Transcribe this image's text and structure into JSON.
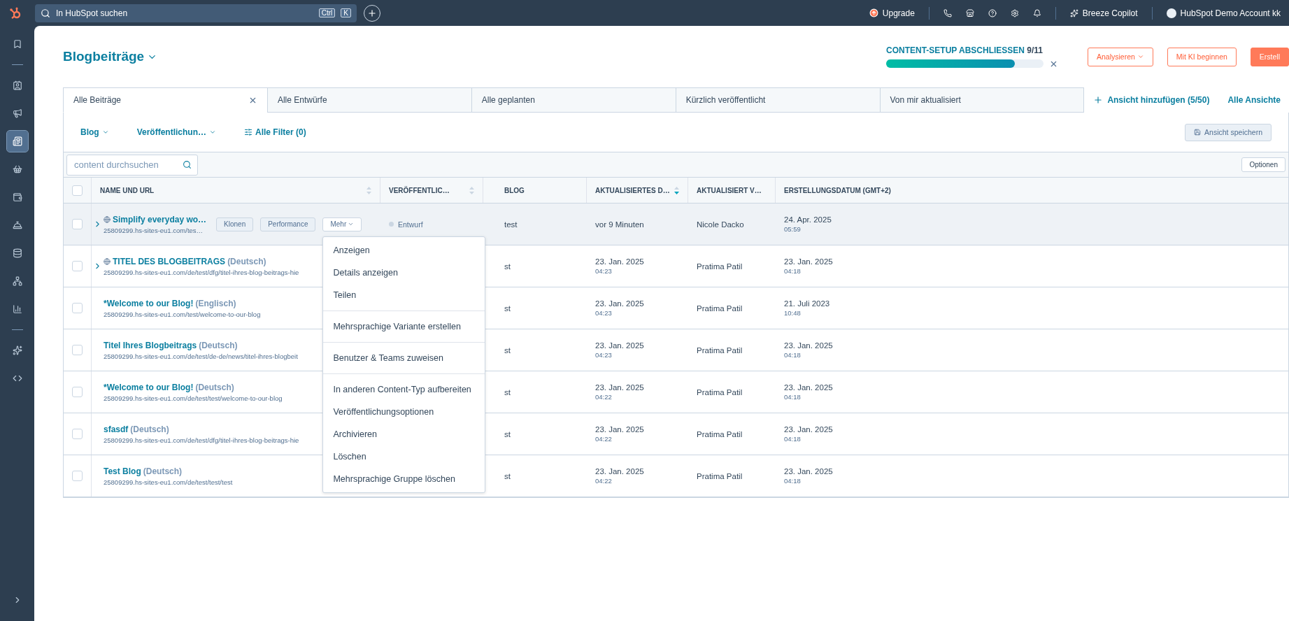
{
  "topbar": {
    "search": {
      "placeholder": "In HubSpot suchen",
      "keys": [
        "Ctrl",
        "K"
      ]
    },
    "upgrade": "Upgrade",
    "copilot": "Breeze Copilot",
    "account": "HubSpot Demo Account kk"
  },
  "sidebar": {
    "items": [
      {
        "kind": "bookmark",
        "selected": false
      },
      {
        "kind": "divider"
      },
      {
        "kind": "contacts",
        "selected": false
      },
      {
        "kind": "megaphone",
        "selected": false
      },
      {
        "kind": "content",
        "selected": true
      },
      {
        "kind": "commerce",
        "selected": false
      },
      {
        "kind": "wallet",
        "selected": false
      },
      {
        "kind": "bell",
        "selected": false
      },
      {
        "kind": "database",
        "selected": false
      },
      {
        "kind": "hierarchy",
        "selected": false
      },
      {
        "kind": "chart",
        "selected": false
      },
      {
        "kind": "divider"
      },
      {
        "kind": "sparkle",
        "selected": false
      },
      {
        "kind": "code",
        "selected": false
      }
    ]
  },
  "header": {
    "title": "Blogbeiträge",
    "setup": {
      "label": "CONTENT-SETUP ABSCHLIESSEN",
      "count": "9/11",
      "level": 0.82
    },
    "buttons": [
      {
        "label": "Analysieren",
        "kind": "outline",
        "dropdown": true
      },
      {
        "label": "Mit KI beginnen",
        "kind": "outline",
        "dropdown": false
      },
      {
        "label": "Erstell",
        "kind": "primary",
        "dropdown": false
      }
    ]
  },
  "views": {
    "tabs": [
      {
        "label": "Alle Beiträge",
        "selected": true
      },
      {
        "label": "Alle Entwürfe",
        "selected": false
      },
      {
        "label": "Alle geplanten",
        "selected": false
      },
      {
        "label": "Kürzlich veröffentlicht",
        "selected": false
      },
      {
        "label": "Von mir aktualisiert",
        "selected": false
      }
    ],
    "add": "Ansicht hinzufügen (5/50)",
    "all": "Alle Ansichte"
  },
  "filters": {
    "dropdowns": [
      "Blog",
      "Veröffentlichun…"
    ],
    "all": "Alle Filter (0)",
    "save": "Ansicht speichern",
    "search_placeholder": "content durchsuchen",
    "options": "Optionen"
  },
  "table": {
    "select_all_checked": false,
    "columns": [
      {
        "label": "NAME UND URL",
        "sortable": true,
        "sorted": false
      },
      {
        "label": "VERÖFFENTLIC…",
        "sortable": true,
        "sorted": false
      },
      {
        "label": "BLOG",
        "sortable": false,
        "sorted": false
      },
      {
        "label": "AKTUALISIERTES D…",
        "sortable": true,
        "sorted": true
      },
      {
        "label": "AKTUALISIERT V…",
        "sortable": false,
        "sorted": false
      },
      {
        "label": "ERSTELLUNGSDATUM (GMT+2)",
        "sortable": false,
        "sorted": false
      }
    ],
    "rows": [
      {
        "checked": false,
        "name": "Simplify everyday wo…",
        "language": "",
        "url": "25809299.hs-sites-eu1.com/tes…",
        "variants": true,
        "hovered": true,
        "actions": [
          "Klonen",
          "Performance",
          "Mehr"
        ],
        "status": "Entwurf",
        "blog": "test",
        "updated": "vor 9 Minuten",
        "updated_time": "",
        "updated_by": "Nicole Dacko",
        "created": "24. Apr. 2025",
        "created_time": "05:59"
      },
      {
        "checked": false,
        "name": "TITEL DES BLOGBEITRAGS",
        "language": "(Deutsch)",
        "url": "25809299.hs-sites-eu1.com/de/test/dfg/titel-ihres-blog-beitrags-hie",
        "variants": true,
        "hovered": false,
        "blog": "st",
        "updated": "23. Jan. 2025",
        "updated_time": "04:23",
        "updated_by": "Pratima Patil",
        "created": "23. Jan. 2025",
        "created_time": "04:18"
      },
      {
        "checked": false,
        "name": "*Welcome to our Blog!",
        "language": "(Englisch)",
        "url": "25809299.hs-sites-eu1.com/test/welcome-to-our-blog",
        "variants": false,
        "hovered": false,
        "blog": "st",
        "updated": "23. Jan. 2025",
        "updated_time": "04:23",
        "updated_by": "Pratima Patil",
        "created": "21. Juli 2023",
        "created_time": "10:48"
      },
      {
        "checked": false,
        "name": "Titel Ihres Blogbeitrags",
        "language": "(Deutsch)",
        "url": "25809299.hs-sites-eu1.com/de/test/de-de/news/titel-ihres-blogbeit",
        "variants": false,
        "hovered": false,
        "blog": "st",
        "updated": "23. Jan. 2025",
        "updated_time": "04:23",
        "updated_by": "Pratima Patil",
        "created": "23. Jan. 2025",
        "created_time": "04:18"
      },
      {
        "checked": false,
        "name": "*Welcome to our Blog!",
        "language": "(Deutsch)",
        "url": "25809299.hs-sites-eu1.com/de/test/test/welcome-to-our-blog",
        "variants": false,
        "hovered": false,
        "blog": "st",
        "updated": "23. Jan. 2025",
        "updated_time": "04:22",
        "updated_by": "Pratima Patil",
        "created": "23. Jan. 2025",
        "created_time": "04:18"
      },
      {
        "checked": false,
        "name": "sfasdf",
        "language": "(Deutsch)",
        "url": "25809299.hs-sites-eu1.com/de/test/dfg/titel-ihres-blog-beitrags-hie",
        "variants": false,
        "hovered": false,
        "blog": "st",
        "updated": "23. Jan. 2025",
        "updated_time": "04:22",
        "updated_by": "Pratima Patil",
        "created": "23. Jan. 2025",
        "created_time": "04:18"
      },
      {
        "checked": false,
        "name": "Test Blog",
        "language": "(Deutsch)",
        "url": "25809299.hs-sites-eu1.com/de/test/test/test",
        "variants": false,
        "hovered": false,
        "blog": "st",
        "updated": "23. Jan. 2025",
        "updated_time": "04:22",
        "updated_by": "Pratima Patil",
        "created": "23. Jan. 2025",
        "created_time": "04:18"
      }
    ]
  },
  "menu": {
    "sections": [
      [
        "Anzeigen",
        "Details anzeigen",
        "Teilen"
      ],
      [
        "Mehrsprachige Variante erstellen"
      ],
      [
        "Benutzer & Teams zuweisen"
      ],
      [
        "In anderen Content-Typ aufbereiten",
        "Veröffentlichungsoptionen",
        "Archivieren",
        "Löschen",
        "Mehrsprachige Gruppe löschen"
      ]
    ]
  }
}
